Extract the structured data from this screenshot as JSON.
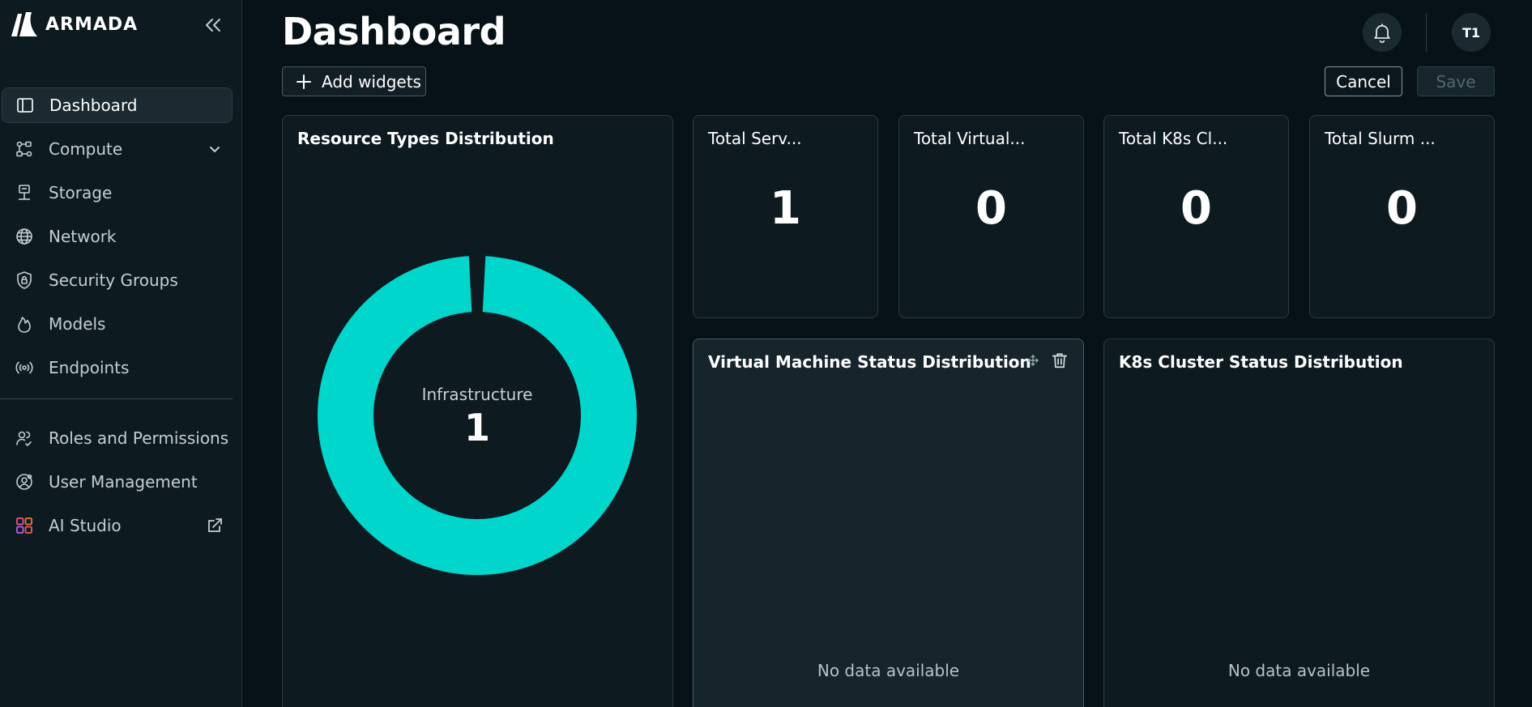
{
  "app": {
    "brand": "ARMADA",
    "page_title": "Dashboard",
    "avatar_initials": "T1",
    "accent": "#00d6cc"
  },
  "sidebar": {
    "items": [
      {
        "label": "Dashboard",
        "icon": "layout-icon",
        "active": true
      },
      {
        "label": "Compute",
        "icon": "compute-icon",
        "expandable": true
      },
      {
        "label": "Storage",
        "icon": "storage-icon"
      },
      {
        "label": "Network",
        "icon": "globe-icon"
      },
      {
        "label": "Security Groups",
        "icon": "shield-lock-icon"
      },
      {
        "label": "Models",
        "icon": "flame-icon"
      },
      {
        "label": "Endpoints",
        "icon": "broadcast-icon"
      }
    ],
    "admin_items": [
      {
        "label": "Roles and Permissions",
        "icon": "users-icon"
      },
      {
        "label": "User Management",
        "icon": "user-settings-icon"
      },
      {
        "label": "AI Studio",
        "icon": "ai-studio-icon",
        "external": true
      }
    ]
  },
  "toolbar": {
    "add_widgets_label": "Add widgets",
    "cancel_label": "Cancel",
    "save_label": "Save"
  },
  "widgets": {
    "resource_types": {
      "title": "Resource Types Distribution",
      "center_label": "Infrastructure",
      "center_value": "1"
    },
    "stats": [
      {
        "title": "Total Serv...",
        "value": "1"
      },
      {
        "title": "Total Virtual...",
        "value": "0"
      },
      {
        "title": "Total K8s Cl...",
        "value": "0"
      },
      {
        "title": "Total Slurm ...",
        "value": "0"
      }
    ],
    "vm_status": {
      "title": "Virtual Machine Status Distribution",
      "empty_text": "No data available"
    },
    "k8s_status": {
      "title": "K8s Cluster Status Distribution",
      "empty_text": "No data available"
    }
  },
  "chart_data": {
    "type": "pie",
    "categories": [
      "Infrastructure"
    ],
    "values": [
      1
    ],
    "title": "Resource Types Distribution",
    "colors": [
      "#00d6cc"
    ]
  }
}
